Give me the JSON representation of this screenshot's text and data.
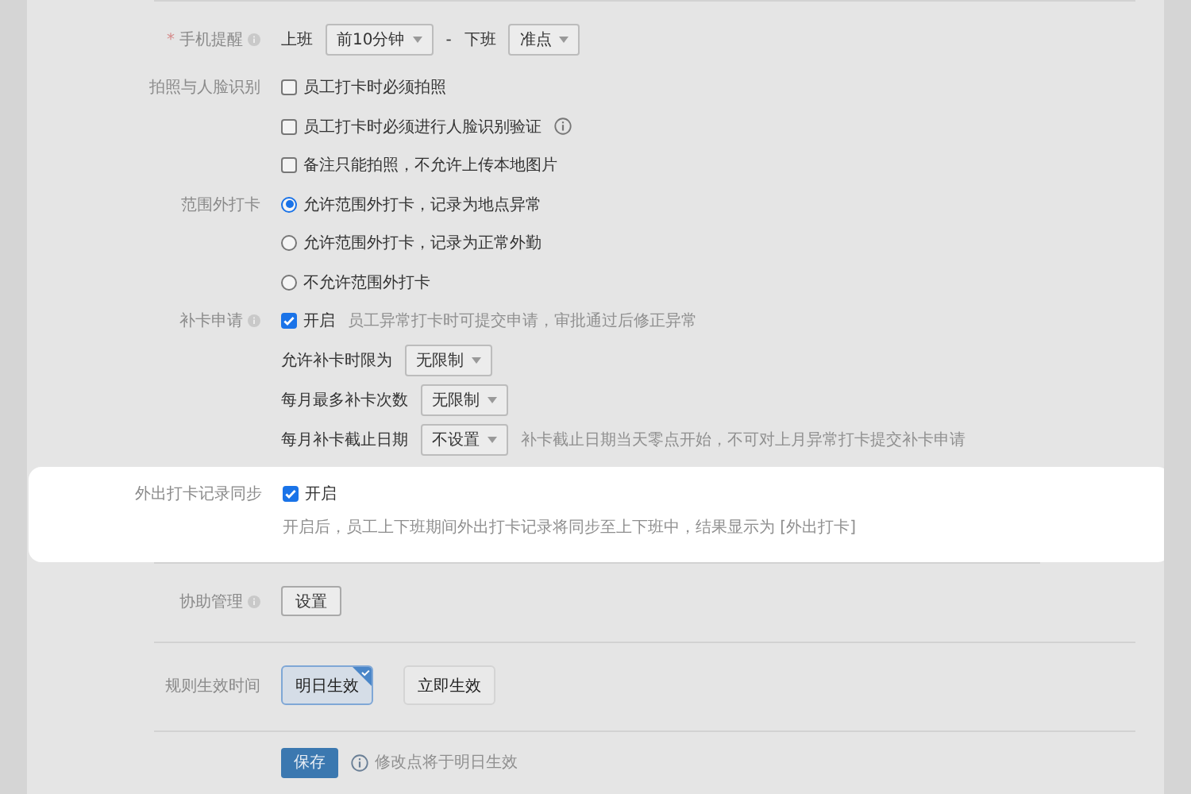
{
  "reminder": {
    "label": "手机提醒",
    "required_mark": "*",
    "start_label": "上班",
    "start_value": "前10分钟",
    "separator": "-",
    "end_label": "下班",
    "end_value": "准点"
  },
  "photo": {
    "label": "拍照与人脸识别",
    "options": [
      {
        "text": "员工打卡时必须拍照",
        "checked": false,
        "info": false
      },
      {
        "text": "员工打卡时必须进行人脸识别验证",
        "checked": false,
        "info": true
      },
      {
        "text": "备注只能拍照，不允许上传本地图片",
        "checked": false,
        "info": false
      }
    ]
  },
  "out_of_range": {
    "label": "范围外打卡",
    "options": [
      {
        "text": "允许范围外打卡，记录为地点异常",
        "selected": true
      },
      {
        "text": "允许范围外打卡，记录为正常外勤",
        "selected": false
      },
      {
        "text": "不允许范围外打卡",
        "selected": false
      }
    ]
  },
  "makeup": {
    "label": "补卡申请",
    "enabled": {
      "text": "开启",
      "checked": true
    },
    "hint": "员工异常打卡时可提交申请，审批通过后修正异常",
    "settings": [
      {
        "label": "允许补卡时限为",
        "value": "无限制"
      },
      {
        "label": "每月最多补卡次数",
        "value": "无限制"
      },
      {
        "label": "每月补卡截止日期",
        "value": "不设置",
        "hint": "补卡截止日期当天零点开始，不可对上月异常打卡提交补卡申请"
      }
    ]
  },
  "sync": {
    "label": "外出打卡记录同步",
    "enabled": {
      "text": "开启",
      "checked": true
    },
    "note": "开启后，员工上下班期间外出打卡记录将同步至上下班中，结果显示为 [外出打卡]"
  },
  "assist": {
    "label": "协助管理",
    "button": "设置"
  },
  "effective": {
    "label": "规则生效时间",
    "options": [
      {
        "text": "明日生效",
        "selected": true
      },
      {
        "text": "立即生效",
        "selected": false
      }
    ]
  },
  "save": {
    "button": "保存",
    "note": "修改点将于明日生效"
  }
}
